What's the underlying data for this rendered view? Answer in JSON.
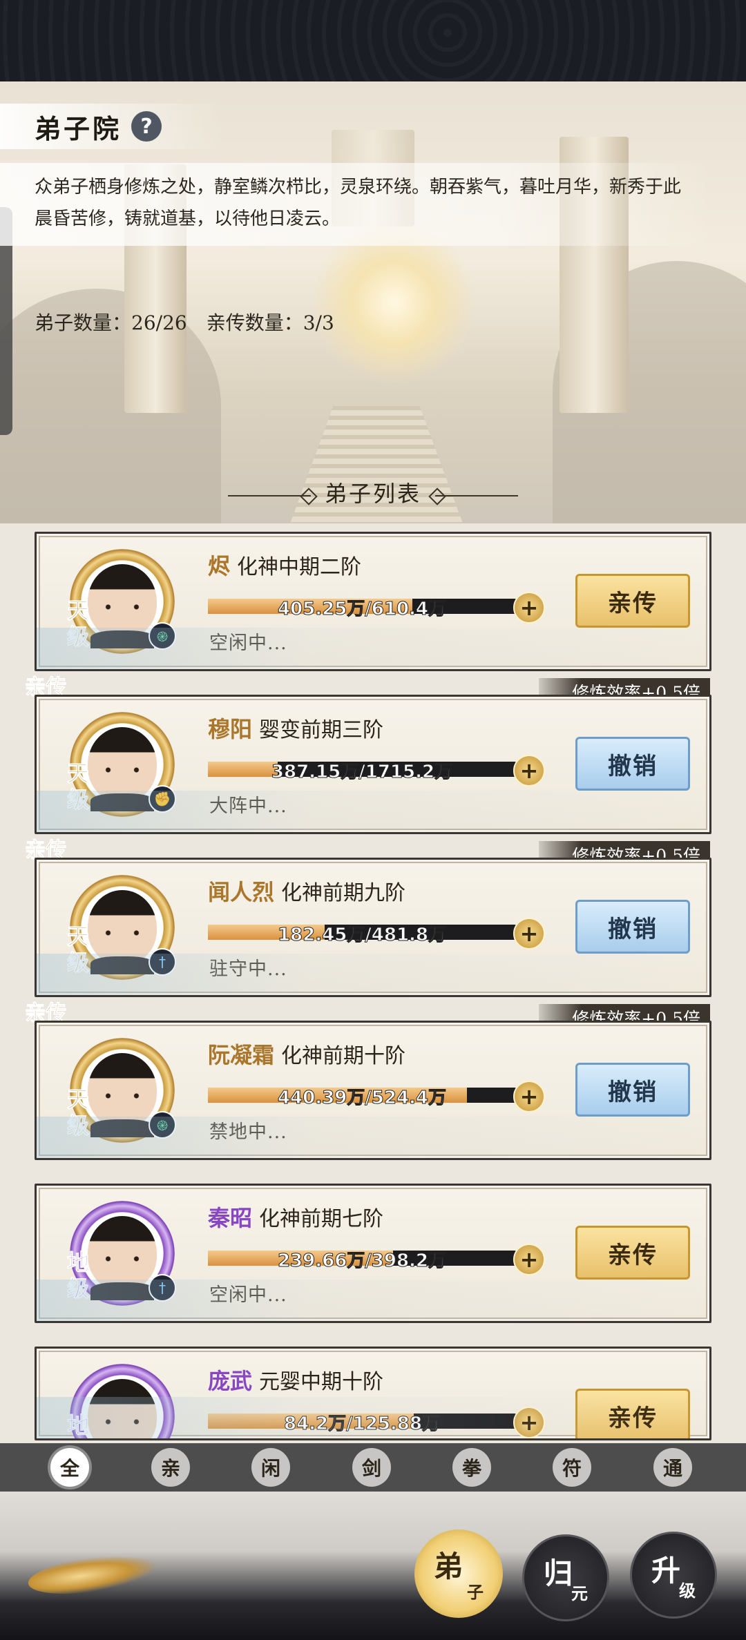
{
  "header": {
    "title": "弟子院",
    "help_icon": "question-mark-icon",
    "help_label": "?"
  },
  "description": "众弟子栖身修炼之处，静室鳞次栉比，灵泉环绕。朝吞紫气，暮吐月华，新秀于此晨昏苦修，铸就道基，以待他日凌云。",
  "counts": {
    "disciples": "弟子数量：26/26",
    "personal": "亲传数量：3/3"
  },
  "list_title": "弟子列表",
  "disciples": [
    {
      "name": "烬",
      "realm": "化神中期二阶",
      "progress_text": "405.25万/610.4万",
      "progress": 0.664,
      "status": "空闲中...",
      "grade": "天级",
      "grade_color": "gold",
      "element_icon": "wind-swirl-icon",
      "element_color": "green",
      "is_personal": false,
      "efficiency": "",
      "action": "亲传",
      "action_style": "gold"
    },
    {
      "name": "穆阳",
      "realm": "婴变前期三阶",
      "progress_text": "387.15万/1715.2万",
      "progress": 0.226,
      "status": "大阵中...",
      "grade": "天级",
      "grade_color": "gold",
      "element_icon": "fist-icon",
      "element_color": "red",
      "is_personal": true,
      "personal_tag": "亲传",
      "efficiency": "修炼效率+0.5倍",
      "action": "撤销",
      "action_style": "blue"
    },
    {
      "name": "闻人烈",
      "realm": "化神前期九阶",
      "progress_text": "182.45万/481.8万",
      "progress": 0.379,
      "status": "驻守中...",
      "grade": "天级",
      "grade_color": "gold",
      "element_icon": "sword-icon",
      "element_color": "blue",
      "is_personal": true,
      "personal_tag": "亲传",
      "efficiency": "修炼效率+0.5倍",
      "action": "撤销",
      "action_style": "blue"
    },
    {
      "name": "阮凝霜",
      "realm": "化神前期十阶",
      "progress_text": "440.39万/524.4万",
      "progress": 0.84,
      "status": "禁地中...",
      "grade": "天级",
      "grade_color": "gold",
      "element_icon": "wind-swirl-icon",
      "element_color": "green",
      "is_personal": true,
      "personal_tag": "亲传",
      "efficiency": "修炼效率+0.5倍",
      "action": "撤销",
      "action_style": "blue"
    },
    {
      "name": "秦昭",
      "realm": "化神前期七阶",
      "progress_text": "239.66万/398.2万",
      "progress": 0.602,
      "status": "空闲中...",
      "grade": "地级",
      "grade_color": "purple",
      "element_icon": "sword-icon",
      "element_color": "blue",
      "is_personal": false,
      "efficiency": "",
      "action": "亲传",
      "action_style": "gold"
    },
    {
      "name": "庞武",
      "realm": "元婴中期十阶",
      "progress_text": "84.2万/125.88万",
      "progress": 0.669,
      "status": "",
      "grade": "地级",
      "grade_color": "purple",
      "element_icon": "",
      "element_color": "",
      "is_personal": false,
      "efficiency": "",
      "action": "亲传",
      "action_style": "gold"
    }
  ],
  "filters": [
    "全",
    "亲",
    "闲",
    "剑",
    "拳",
    "符",
    "通"
  ],
  "active_filter": "全",
  "bottom_nav": [
    {
      "main": "弟",
      "sub": "子",
      "active": true
    },
    {
      "main": "归",
      "sub": "元",
      "active": false
    },
    {
      "main": "升",
      "sub": "级",
      "active": false
    }
  ],
  "colors": {
    "gold_name": "#a9762b",
    "purple_name": "#8846c2",
    "dark_bar": "#1d1d20"
  }
}
